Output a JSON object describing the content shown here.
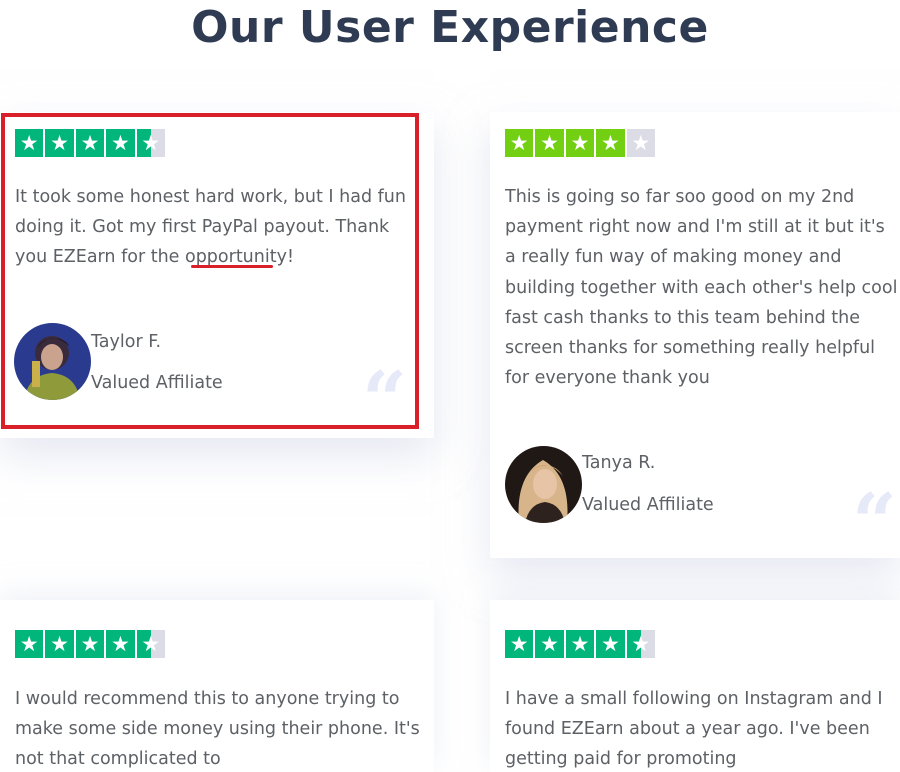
{
  "page": {
    "title": "Our User Experience"
  },
  "colors": {
    "title": "#2e3b52",
    "text": "#5d6166",
    "star_green": "#00b67a",
    "star_lime": "#73cf11",
    "star_empty": "#dcdce6",
    "highlight": "#d81f2a",
    "quote_mark": "#e6e9f8"
  },
  "reviews": [
    {
      "rating": 4.5,
      "star_color": "#00b67a",
      "text": "It took some honest hard work, but I had fun doing it. Got my first PayPal payout. Thank you EZEarn for the opportunity!",
      "author_name": "Taylor F.",
      "author_role": "Valued Affiliate",
      "avatar_icon": "user-avatar-icon",
      "quote_icon": "quote-icon"
    },
    {
      "rating": 4,
      "star_color": "#73cf11",
      "text": "This is going so far soo good on my 2nd payment right now and I'm still at it but it's a really fun way of making money and building together with each other's help cool fast cash thanks to this team behind the screen thanks for something really helpful for everyone thank you",
      "author_name": "Tanya R.",
      "author_role": "Valued Affiliate",
      "avatar_icon": "user-avatar-icon",
      "quote_icon": "quote-icon"
    },
    {
      "rating": 4.5,
      "star_color": "#00b67a",
      "text": "I would recommend this to anyone trying to make some side money using their phone. It's not that complicated to"
    },
    {
      "rating": 4.5,
      "star_color": "#00b67a",
      "text": "I have a small following on Instagram and I found EZEarn about a year ago. I've been getting paid for promoting"
    }
  ],
  "icons": {
    "star": "★",
    "quote": "“"
  }
}
